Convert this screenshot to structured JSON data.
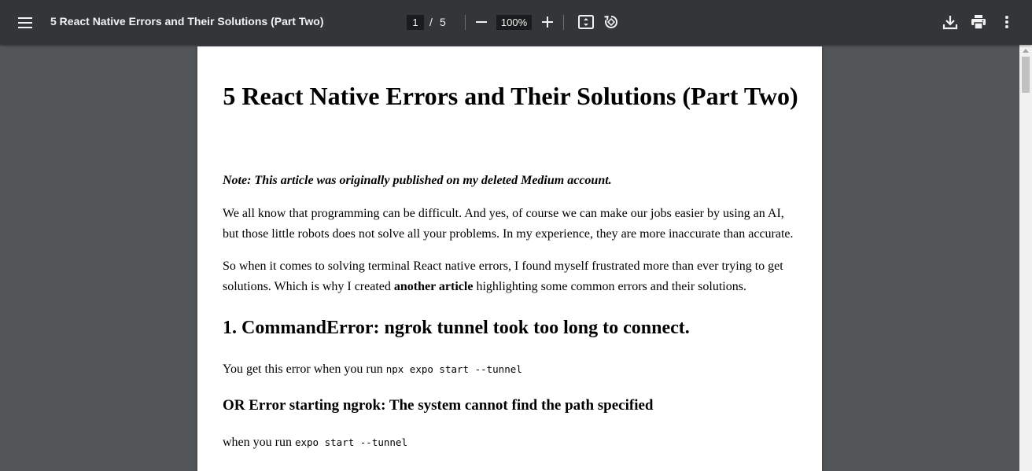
{
  "toolbar": {
    "title": "5 React Native Errors and Their Solutions (Part Two)",
    "current_page": "1",
    "page_separator": "/",
    "total_pages": "5",
    "zoom": "100%",
    "icons": [
      "menu-icon",
      "zoom-out-icon",
      "zoom-in-icon",
      "fit-to-page-icon",
      "rotate-icon",
      "download-icon",
      "print-icon",
      "more-vert-icon"
    ]
  },
  "document": {
    "title": "5 React Native Errors and Their Solutions (Part Two)",
    "note": "Note: This article was originally published on my deleted Medium account.",
    "p1": "We all know that programming can be difficult. And yes, of course we can make our jobs easier by using an AI, but those little robots does not solve all your problems. In my experience, they are more inaccurate than accurate.",
    "p2_before": "So when it comes to solving terminal React native errors, I found myself frustrated more than ever trying to get solutions. Which is why I created ",
    "p2_bold": "another article",
    "p2_after": " highlighting some common errors and their solutions.",
    "h2": "1. CommandError: ngrok tunnel took too long to connect.",
    "p3_text": "You get this error when you run ",
    "p3_code": "npx expo start --tunnel",
    "h3": "OR Error starting ngrok: The system cannot find the path specified",
    "p4_text": "when you run ",
    "p4_code": "expo start --tunnel"
  },
  "colors": {
    "toolbar_bg": "#323639",
    "viewer_bg": "#525659",
    "page_bg": "#ffffff",
    "input_bg": "#191b1c"
  }
}
